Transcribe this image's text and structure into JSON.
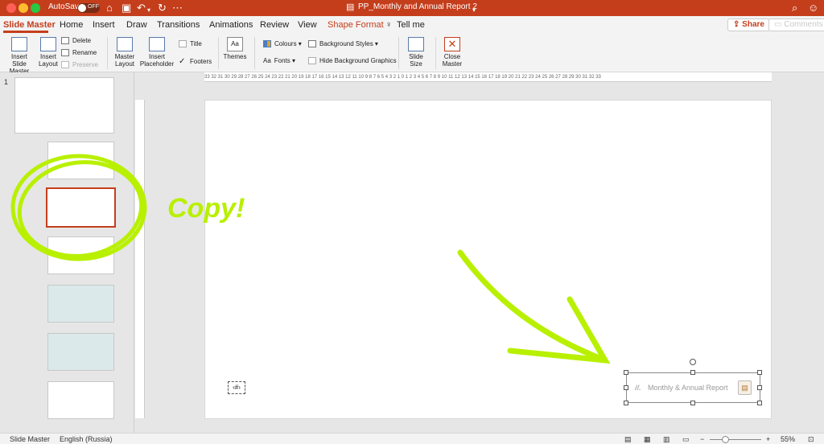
{
  "titlebar": {
    "autosave_label": "AutoSave",
    "autosave_state": "OFF",
    "doc_title": "PP_Monthly and Annual Report 2",
    "traffic_colors": [
      "#ff5f57",
      "#febc2e",
      "#28c840"
    ]
  },
  "tabs": {
    "items": [
      "Slide Master",
      "Home",
      "Insert",
      "Draw",
      "Transitions",
      "Animations",
      "Review",
      "View",
      "Shape Format"
    ],
    "tell_me": "Tell me",
    "active": "Slide Master",
    "share": "Share",
    "comments": "Comments"
  },
  "ribbon": {
    "insert_slide_master": "Insert Slide Master",
    "insert_layout": "Insert Layout",
    "delete": "Delete",
    "rename": "Rename",
    "preserve": "Preserve",
    "master_layout": "Master Layout",
    "insert_placeholder": "Insert Placeholder",
    "title": "Title",
    "footers": "Footers",
    "themes": "Themes",
    "colours": "Colours",
    "fonts": "Fonts",
    "background_styles": "Background Styles",
    "hide_background_graphics": "Hide Background Graphics",
    "slide_size": "Slide Size",
    "close_master": "Close Master"
  },
  "panel": {
    "first_number": "1"
  },
  "slide": {
    "slide_number_placeholder": "‹#›",
    "footer_logo": "//.",
    "footer_text": "Monthly & Annual Report"
  },
  "annotation": {
    "text": "Copy!",
    "color": "#b8f000"
  },
  "statusbar": {
    "view": "Slide Master",
    "language": "English (Russia)",
    "zoom": "55%",
    "zoom_minus": "−",
    "zoom_plus": "+"
  },
  "ruler": {
    "horizontal_text": "33 32 31 30 29 28 27 26 25 24 23 22 21 20 19 18 17 16 15 14 13 12 11 10 9 8 7 6 5 4 3 2 1 0 1 2 3 4 5 6 7 8 9 10 11 12 13 14 15 16 17 18 19 20 21 22 23 24 25 26 27 28 29 30 31 32 33"
  }
}
